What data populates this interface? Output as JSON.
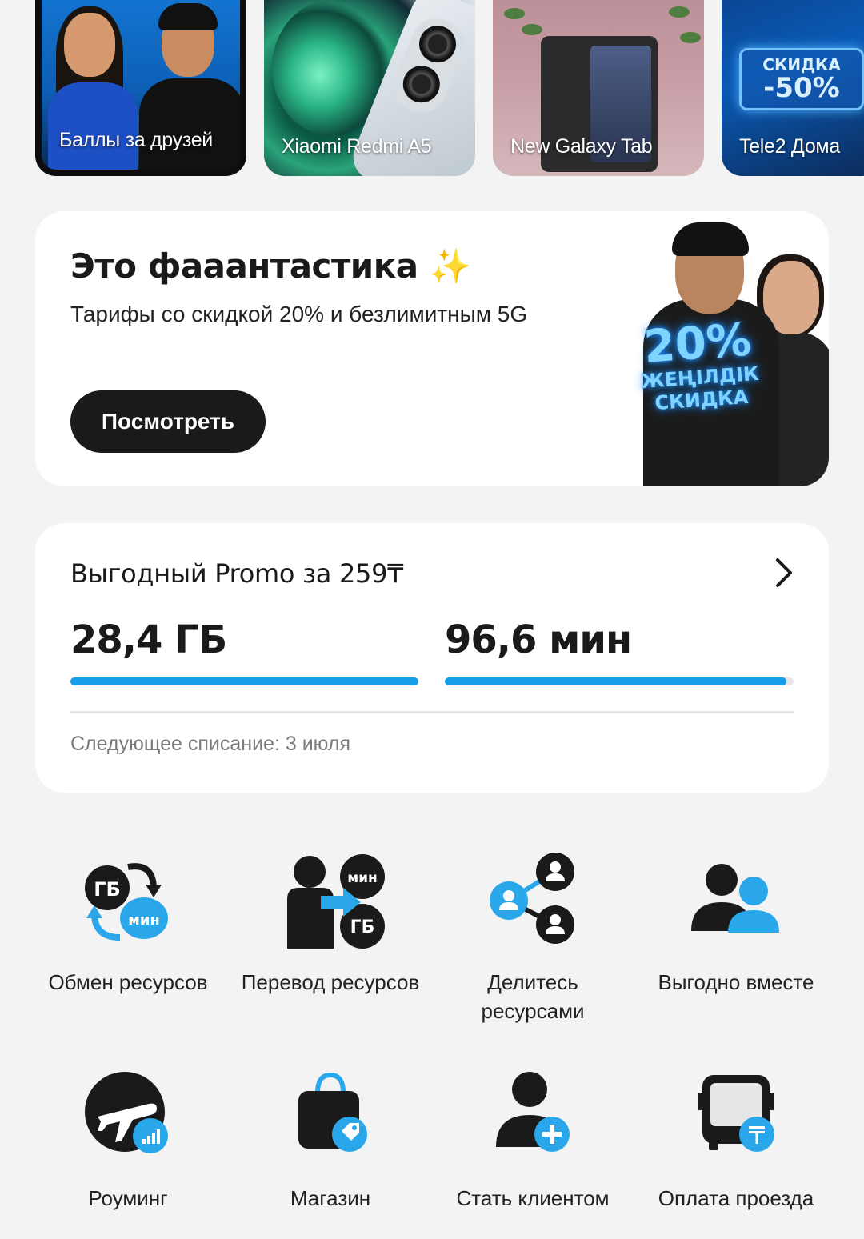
{
  "stories": [
    {
      "label": "Баллы за друзей"
    },
    {
      "label": "Xiaomi Redmi A5"
    },
    {
      "label": "New Galaxy Tab"
    },
    {
      "label": "Tele2 Дома"
    }
  ],
  "story_sign": {
    "line1": "СКИДКА",
    "line2": "-50%"
  },
  "promo": {
    "title": "Это фааантастика",
    "sparkles": "✨",
    "subtitle": "Тарифы со скидкой 20% и безлимитным 5G",
    "button": "Посмотреть",
    "badge_line1": "20%",
    "badge_line2": "ЖЕҢІЛДІК",
    "badge_line3": "СКИДКА"
  },
  "plan": {
    "title": "Выгодный Promo за 259₸",
    "data_value": "28,4 ГБ",
    "minutes_value": "96,6 мин",
    "data_fill_fraction": 1.0,
    "minutes_fill_fraction": 0.98,
    "next_charge": "Следующее списание: 3 июля"
  },
  "services": [
    {
      "label": "Обмен ресурсов",
      "icon": "exchange-resources-icon",
      "badge_gb": "ГБ",
      "badge_min": "мин"
    },
    {
      "label": "Перевод ресурсов",
      "icon": "transfer-resources-icon",
      "badge_gb": "ГБ",
      "badge_min": "мин"
    },
    {
      "label": "Делитесь ресурсами",
      "icon": "share-resources-icon"
    },
    {
      "label": "Выгодно вместе",
      "icon": "together-icon"
    },
    {
      "label": "Роуминг",
      "icon": "roaming-icon"
    },
    {
      "label": "Магазин",
      "icon": "shop-icon"
    },
    {
      "label": "Стать клиентом",
      "icon": "become-client-icon"
    },
    {
      "label": "Оплата проезда",
      "icon": "transit-payment-icon"
    }
  ],
  "colors": {
    "accent": "#169fe8",
    "dark": "#1a1a1a",
    "background": "#f3f3f3"
  }
}
